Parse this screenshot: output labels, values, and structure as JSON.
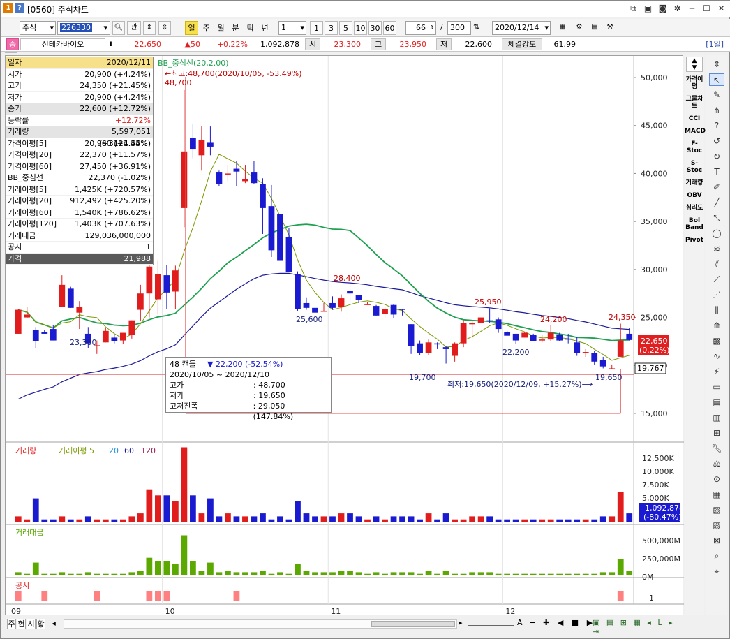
{
  "window": {
    "badge1": "1",
    "badge2": "?",
    "title": "[0560] 주식차트"
  },
  "toolbar": {
    "market": "주식",
    "code": "226330",
    "btn_search": "관",
    "periods": [
      "일",
      "주",
      "월",
      "분",
      "틱",
      "년"
    ],
    "active_period": "일",
    "sub_select": "1",
    "minutes": [
      "1",
      "3",
      "5",
      "10",
      "30",
      "60"
    ],
    "count": "66",
    "slash": "/",
    "total": "300",
    "date": "2020/12/14"
  },
  "quote": {
    "badge": "중",
    "name": "신테카바이오",
    "info": "i",
    "price": "22,650",
    "change": "▲50",
    "change_pct": "+0.22%",
    "volume": "1,092,878",
    "open_label": "시",
    "open": "23,300",
    "high_label": "고",
    "high": "23,950",
    "low_label": "저",
    "low": "22,600",
    "strength_label": "체결강도",
    "strength": "61.99",
    "period_tag": "[1일]"
  },
  "datawindow": [
    {
      "k": "일자",
      "v": "2020/12/11",
      "style": "head"
    },
    {
      "k": "시가",
      "v": "20,900 (+4.24%)"
    },
    {
      "k": "고가",
      "v": "24,350 (+21.45%)"
    },
    {
      "k": "저가",
      "v": "20,900 (+4.24%)"
    },
    {
      "k": "종가",
      "v": "22,600 (+12.72%)",
      "style": "hl"
    },
    {
      "k": "등락률",
      "v": "+12.72%",
      "red": true
    },
    {
      "k": "거래량",
      "v": "5,597,051 (+3121.45%)",
      "style": "hl"
    },
    {
      "k": "가격이평[5]",
      "v": "20,960 (+4.54%)"
    },
    {
      "k": "가격이평[20]",
      "v": "22,370 (+11.57%)"
    },
    {
      "k": "가격이평[60]",
      "v": "27,450 (+36.91%)"
    },
    {
      "k": "BB_중심선",
      "v": "22,370 (-1.02%)"
    },
    {
      "k": "거래이평[5]",
      "v": "1,425K (+720.57%)"
    },
    {
      "k": "거래이평[20]",
      "v": "912,492 (+425.20%)"
    },
    {
      "k": "거래이평[60]",
      "v": "1,540K (+786.62%)"
    },
    {
      "k": "거래이평[120]",
      "v": "1,403K (+707.63%)"
    },
    {
      "k": "거래대금",
      "v": "129,036,000,000"
    },
    {
      "k": "공시",
      "v": "1"
    },
    {
      "k": "가격",
      "v": "21,988",
      "style": "dark"
    }
  ],
  "price_panel": {
    "legend": "BB_중심선(20,2.00)",
    "max_note": "←최고:48,700(2020/10/05, -53.49%)",
    "min_note": "최저:19,650(2020/12/09, +15.27%)⟶",
    "y_ticks": [
      "50,000",
      "45,000",
      "40,000",
      "35,000",
      "30,000",
      "25,000",
      "20,000",
      "15,000"
    ],
    "current_price": "22,650",
    "current_pct": "(0.22%)",
    "cursor_price": "19,767",
    "labels": [
      {
        "text": "48,700",
        "color": "#c00000"
      },
      {
        "text": "23,300",
        "color": "#1a237e"
      },
      {
        "text": "28,400",
        "color": "#c00000"
      },
      {
        "text": "25,600",
        "color": "#1a237e"
      },
      {
        "text": "19,700",
        "color": "#1a237e"
      },
      {
        "text": "25,950",
        "color": "#c00000"
      },
      {
        "text": "22,200",
        "color": "#1a237e"
      },
      {
        "text": "24,200",
        "color": "#c00000"
      },
      {
        "text": "24,350",
        "color": "#c00000"
      },
      {
        "text": "19,650",
        "color": "#1a237e"
      }
    ]
  },
  "info_box": {
    "title": "48 캔들",
    "change": "▼ 22,200 (-52.54%)",
    "range": "2020/10/05 ~ 2020/12/10",
    "high_k": "고가",
    "high_v": ": 48,700",
    "low_k": "저가",
    "low_v": ": 19,650",
    "span_k": "고저진폭",
    "span_v": ": 29,050 (147.84%)"
  },
  "volume_panel": {
    "legend_vol": "거래량",
    "legend_ma": "거래이평 5",
    "legend_20": "20",
    "legend_60": "60",
    "legend_120": "120",
    "y_ticks": [
      "12,500K",
      "10,000K",
      "7,500K",
      "5,000K"
    ],
    "current": "1,092,878",
    "current_pct": "(-80.47%)"
  },
  "amount_panel": {
    "legend": "거래대금",
    "y_ticks": [
      "500,000M",
      "250,000M",
      "0M"
    ]
  },
  "notice_panel": {
    "legend": "공시",
    "y_tick": "1"
  },
  "x_axis": [
    "09",
    "10",
    "11",
    "12"
  ],
  "bottom_tabs": [
    "주",
    "현",
    "시",
    "황"
  ],
  "side_indicators": [
    "가격이평",
    "그물차트",
    "CCI",
    "MACD",
    "F-Stoc",
    "S-Stoc",
    "거래량",
    "OBV",
    "심리도",
    "Bol Band",
    "Pivot"
  ],
  "colors": {
    "up": "#e11c1c",
    "down": "#1a1ad0",
    "ma5": "#7a9a00",
    "bb_mid": "#1fa050",
    "ma60": "#1a1a9a",
    "amount": "#5aa800",
    "notice": "#ff8080"
  },
  "chart_data": {
    "type": "candlestick",
    "ylim": [
      13000,
      52000
    ],
    "candles": [
      [
        23300,
        25800,
        23300,
        25900
      ],
      [
        25000,
        25300,
        24900,
        26100
      ],
      [
        23700,
        22500,
        21800,
        24000
      ],
      [
        23500,
        23300,
        23400,
        23700
      ],
      [
        23800,
        22600,
        23000,
        24200
      ],
      [
        26100,
        28400,
        28400,
        29400
      ],
      [
        28000,
        26000,
        26000,
        28200
      ],
      [
        25500,
        26100,
        23800,
        26700
      ],
      [
        23300,
        22300,
        21800,
        24000
      ],
      [
        22000,
        22100,
        21200,
        22600
      ],
      [
        22400,
        23600,
        23300,
        23900
      ],
      [
        22900,
        22500,
        22300,
        23200
      ],
      [
        22600,
        23400,
        22400,
        22200
      ],
      [
        23200,
        24700,
        22800,
        23500
      ],
      [
        25800,
        27500,
        24600,
        28400
      ],
      [
        27500,
        30300,
        25000,
        30700
      ],
      [
        26900,
        29500,
        25300,
        30900
      ],
      [
        29400,
        27600,
        25900,
        30500
      ],
      [
        27700,
        29900,
        25900,
        30400
      ],
      [
        36400,
        42300,
        34400,
        48700
      ],
      [
        43700,
        42500,
        41600,
        45200
      ],
      [
        41900,
        43500,
        40300,
        44900
      ],
      [
        43200,
        42800,
        41900,
        44900
      ],
      [
        40100,
        38900,
        38700,
        40300
      ],
      [
        40000,
        40000,
        39200,
        40900
      ],
      [
        40500,
        40200,
        38700,
        41300
      ],
      [
        39200,
        39400,
        39000,
        40900
      ],
      [
        40100,
        39000,
        38900,
        41300
      ],
      [
        38900,
        36400,
        33700,
        39500
      ],
      [
        36600,
        32000,
        31300,
        38800
      ],
      [
        35800,
        30900,
        31000,
        35300
      ],
      [
        33400,
        29700,
        29800,
        34300
      ],
      [
        29500,
        25900,
        25700,
        29800
      ],
      [
        26500,
        26000,
        25800,
        27100
      ],
      [
        26000,
        25500,
        25300,
        26100
      ],
      [
        25700,
        25700,
        25800,
        26500
      ],
      [
        26500,
        26000,
        25800,
        27200
      ],
      [
        26100,
        27000,
        25600,
        27400
      ],
      [
        27800,
        27500,
        26300,
        28400
      ],
      [
        27300,
        26800,
        26500,
        27300
      ],
      [
        26300,
        26400,
        26300,
        26600
      ],
      [
        26200,
        25200,
        25200,
        26300
      ],
      [
        25400,
        25900,
        25000,
        26100
      ],
      [
        26300,
        25300,
        24900,
        26400
      ],
      [
        25900,
        25800,
        25200,
        25900
      ],
      [
        24300,
        22000,
        21200,
        24300
      ],
      [
        22300,
        21300,
        21100,
        22600
      ],
      [
        21300,
        22400,
        21100,
        22700
      ],
      [
        22300,
        22200,
        21700,
        22400
      ],
      [
        21900,
        21700,
        20200,
        22000
      ],
      [
        21000,
        22300,
        20400,
        22400
      ],
      [
        22300,
        24400,
        21900,
        24700
      ],
      [
        24400,
        24400,
        22900,
        24600
      ],
      [
        24400,
        25000,
        24400,
        25000
      ],
      [
        24700,
        24600,
        24400,
        25950
      ],
      [
        24800,
        23800,
        23400,
        25000
      ],
      [
        23500,
        23100,
        23300,
        23600
      ],
      [
        23300,
        22600,
        22200,
        22800
      ],
      [
        22900,
        23400,
        23000,
        23500
      ],
      [
        23200,
        22500,
        22500,
        23300
      ],
      [
        22700,
        22700,
        22400,
        23200
      ],
      [
        22700,
        23400,
        22500,
        24200
      ],
      [
        23200,
        22600,
        22500,
        23400
      ],
      [
        22800,
        22700,
        22300,
        23300
      ],
      [
        22400,
        21300,
        21000,
        23000
      ],
      [
        21300,
        21400,
        20900,
        21700
      ],
      [
        21300,
        20400,
        20100,
        21500
      ],
      [
        20600,
        19900,
        19700,
        20900
      ],
      [
        19700,
        19700,
        19650,
        20100
      ],
      [
        20900,
        22600,
        20900,
        24350
      ],
      [
        23300,
        22650,
        22600,
        23950
      ]
    ]
  }
}
